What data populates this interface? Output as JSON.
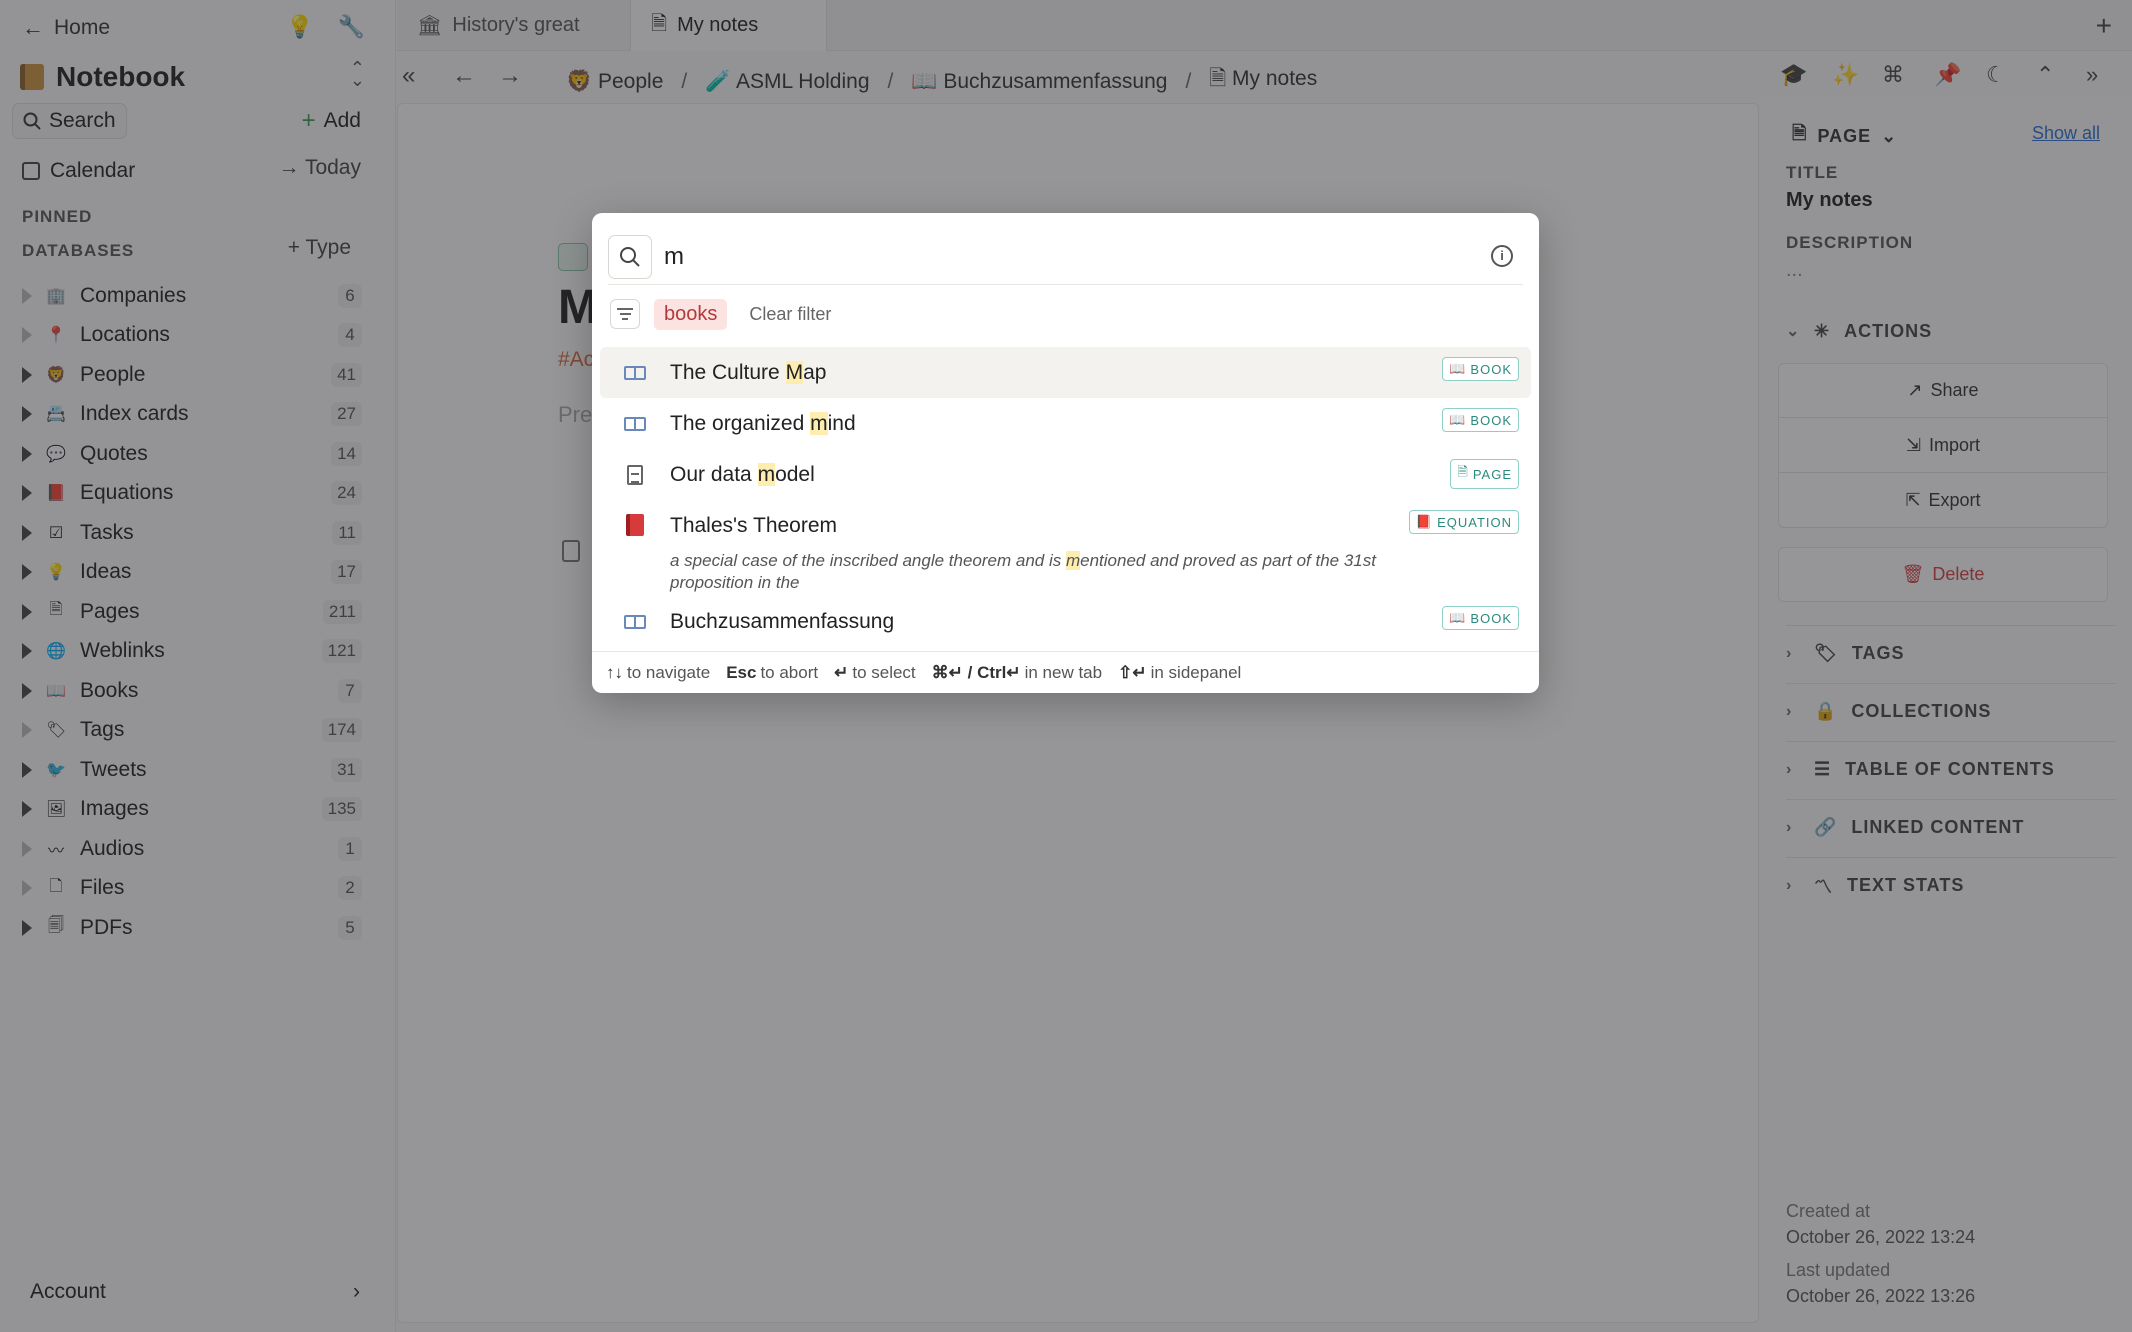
{
  "sidebar": {
    "home_label": "Home",
    "notebook_title": "Notebook",
    "search_label": "Search",
    "add_label": "Add",
    "calendar_label": "Calendar",
    "today_label": "Today",
    "pinned_label": "PINNED",
    "databases_label": "DATABASES",
    "type_label": "Type",
    "databases": [
      {
        "label": "Companies",
        "count": "6",
        "icon": "building-icon"
      },
      {
        "label": "Locations",
        "count": "4",
        "icon": "pin-icon"
      },
      {
        "label": "People",
        "count": "41",
        "icon": "person-icon"
      },
      {
        "label": "Index cards",
        "count": "27",
        "icon": "card-icon"
      },
      {
        "label": "Quotes",
        "count": "14",
        "icon": "speech-bubble-icon"
      },
      {
        "label": "Equations",
        "count": "24",
        "icon": "red-book-icon"
      },
      {
        "label": "Tasks",
        "count": "11",
        "icon": "checkbox-icon"
      },
      {
        "label": "Ideas",
        "count": "17",
        "icon": "bulb-icon"
      },
      {
        "label": "Pages",
        "count": "211",
        "icon": "page-icon"
      },
      {
        "label": "Weblinks",
        "count": "121",
        "icon": "globe-icon"
      },
      {
        "label": "Books",
        "count": "7",
        "icon": "book-icon"
      },
      {
        "label": "Tags",
        "count": "174",
        "icon": "tag-icon"
      },
      {
        "label": "Tweets",
        "count": "31",
        "icon": "bird-icon"
      },
      {
        "label": "Images",
        "count": "135",
        "icon": "image-icon"
      },
      {
        "label": "Audios",
        "count": "1",
        "icon": "waveform-icon"
      },
      {
        "label": "Files",
        "count": "2",
        "icon": "file-icon"
      },
      {
        "label": "PDFs",
        "count": "5",
        "icon": "pdf-icon"
      }
    ],
    "account_label": "Account"
  },
  "tabs": [
    {
      "label": "History's great",
      "icon": "museum-icon"
    },
    {
      "label": "My notes",
      "icon": "page-icon"
    }
  ],
  "breadcrumb": [
    "People",
    "ASML Holding",
    "Buchzusammenfassung",
    "My notes"
  ],
  "page": {
    "title_partial": "M",
    "tag_partial": "#Ac",
    "preview_partial": "Pre"
  },
  "right_panel": {
    "header": "PAGE",
    "show_all": "Show all",
    "title_label": "TITLE",
    "title_value": "My notes",
    "description_label": "DESCRIPTION",
    "description_value": "...",
    "actions_label": "ACTIONS",
    "share_label": "Share",
    "import_label": "Import",
    "export_label": "Export",
    "delete_label": "Delete",
    "sections": [
      "TAGS",
      "COLLECTIONS",
      "TABLE OF CONTENTS",
      "LINKED CONTENT",
      "TEXT STATS"
    ],
    "created_label": "Created at",
    "created_value": "October 26, 2022 13:24",
    "updated_label": "Last updated",
    "updated_value": "October 26, 2022 13:26"
  },
  "palette": {
    "query": "m",
    "filter_chip": "books",
    "clear_filter": "Clear filter",
    "results": [
      {
        "pre": "The Culture ",
        "hl": "M",
        "post": "ap",
        "badge": "BOOK",
        "icon": "book-icon"
      },
      {
        "pre": "The organized ",
        "hl": "m",
        "post": "ind",
        "badge": "BOOK",
        "icon": "book-icon"
      },
      {
        "pre": "Our data ",
        "hl": "m",
        "post": "odel",
        "badge": "PAGE",
        "icon": "page-icon"
      },
      {
        "pre": "Thales's Theorem",
        "hl": "",
        "post": "",
        "badge": "EQUATION",
        "icon": "equation-icon",
        "sub_pre": "a special case of the inscribed angle theorem and is ",
        "sub_hl": "m",
        "sub_post": "entioned and proved as part of the 31st proposition in the"
      },
      {
        "pre": "Buchzusammenfassung",
        "hl": "",
        "post": "",
        "badge": "BOOK",
        "icon": "book-icon"
      }
    ],
    "footer": [
      {
        "key": "↑↓",
        "text": "to navigate"
      },
      {
        "key": "Esc",
        "text": "to abort"
      },
      {
        "key": "↵",
        "text": "to select"
      },
      {
        "key": "⌘↵ / Ctrl↵",
        "text": "in new tab"
      },
      {
        "key": "⇧↵",
        "text": "in sidepanel"
      }
    ]
  }
}
